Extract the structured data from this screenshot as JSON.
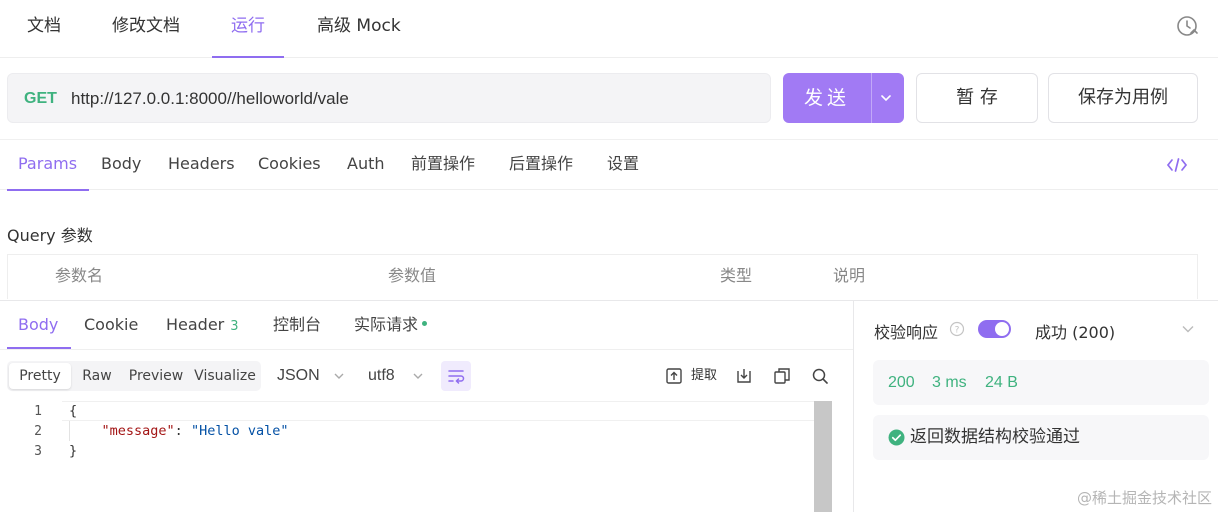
{
  "top_tabs": [
    "文档",
    "修改文档",
    "运行",
    "高级 Mock"
  ],
  "request": {
    "method": "GET",
    "url": "http://127.0.0.1:8000//helloworld/vale",
    "send_label": "发送",
    "draft_label": "暂 存",
    "save_case_label": "保存为用例"
  },
  "request_tabs": [
    "Params",
    "Body",
    "Headers",
    "Cookies",
    "Auth",
    "前置操作",
    "后置操作",
    "设置"
  ],
  "query": {
    "title": "Query 参数",
    "headers": [
      "参数名",
      "参数值",
      "类型",
      "说明"
    ]
  },
  "response": {
    "tabs": [
      "Body",
      "Cookie",
      "Header",
      "控制台",
      "实际请求"
    ],
    "header_count": "3",
    "view_modes": [
      "Pretty",
      "Raw",
      "Preview",
      "Visualize"
    ],
    "format": "JSON",
    "encoding": "utf8",
    "extract_label": "提取",
    "lines": [
      "1",
      "2",
      "3"
    ],
    "code": {
      "open": "{",
      "key": "\"message\"",
      "colon": ": ",
      "value": "\"Hello vale\"",
      "close": "}"
    }
  },
  "validation": {
    "label": "校验响应",
    "enabled": true,
    "status": "成功 (200)",
    "status_code": "200",
    "time": "3 ms",
    "size": "24 B",
    "message": "返回数据结构校验通过"
  },
  "colors": {
    "accent": "#8f6df0",
    "success": "#3fb27f"
  },
  "watermark": "@稀土掘金技术社区"
}
